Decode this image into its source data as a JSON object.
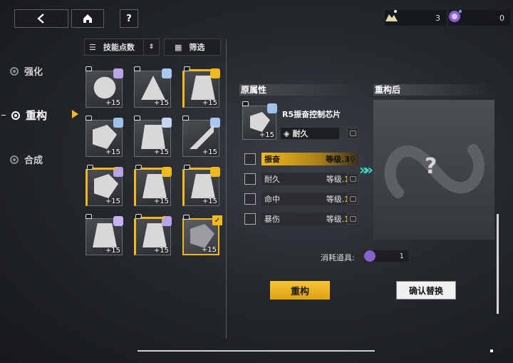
{
  "topbar": {
    "back_icon": "chevron-left",
    "home_icon": "home",
    "help_label": "?",
    "resource1": {
      "icon": "material-pile-icon",
      "count": "3"
    },
    "resource2": {
      "icon": "purple-orb-icon",
      "count": "0"
    }
  },
  "nav": {
    "items": [
      {
        "label": "强化",
        "active": false
      },
      {
        "label": "重构",
        "active": true
      },
      {
        "label": "合成",
        "active": false
      }
    ]
  },
  "sort": {
    "sort_label": "技能点数",
    "filter_label": "筛选"
  },
  "chips": [
    {
      "plus": "+15",
      "gold": false
    },
    {
      "plus": "+15",
      "gold": false
    },
    {
      "plus": "+15",
      "gold": true
    },
    {
      "plus": "+15",
      "gold": false
    },
    {
      "plus": "+15",
      "gold": false
    },
    {
      "plus": "+15",
      "gold": false
    },
    {
      "plus": "+15",
      "gold": true
    },
    {
      "plus": "+15",
      "gold": true
    },
    {
      "plus": "+15",
      "gold": true
    },
    {
      "plus": "+15",
      "gold": false
    },
    {
      "plus": "+15",
      "gold": true
    },
    {
      "plus": "+15",
      "gold": false,
      "selected": true
    }
  ],
  "original": {
    "heading": "原属性",
    "chip_name": "R5振奋控制芯片",
    "chip_plus": "+15",
    "main_stat": "耐久",
    "level_label": "等级.",
    "stats": [
      {
        "name": "振奋",
        "level": "3",
        "highlight": true
      },
      {
        "name": "耐久",
        "level": "1",
        "highlight": false
      },
      {
        "name": "命中",
        "level": "1",
        "highlight": false
      },
      {
        "name": "暴伤",
        "level": "1",
        "highlight": false
      }
    ]
  },
  "after": {
    "heading": "重构后",
    "placeholder": "?"
  },
  "cost": {
    "label": "消耗道具:",
    "count": "1"
  },
  "buttons": {
    "reconstruct": "重构",
    "confirm_replace": "确认替换"
  }
}
